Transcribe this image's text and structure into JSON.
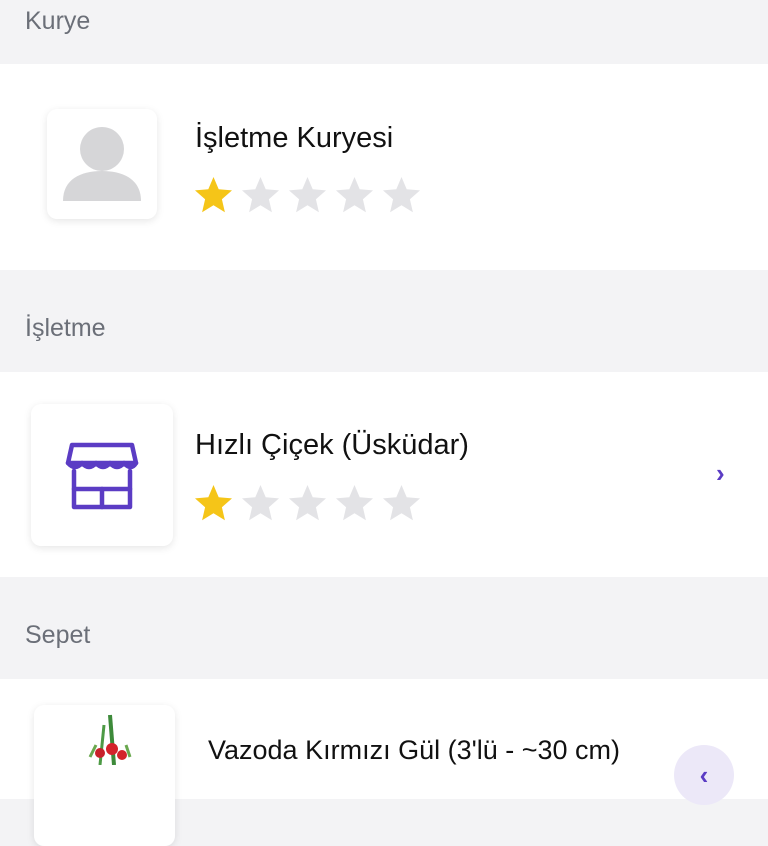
{
  "courier": {
    "section_label": "Kurye",
    "name": "İşletme Kuryesi",
    "rating": 1,
    "rating_max": 5
  },
  "business": {
    "section_label": "İşletme",
    "name": "Hızlı Çiçek (Üsküdar)",
    "rating": 1,
    "rating_max": 5
  },
  "basket": {
    "section_label": "Sepet",
    "item_name": "Vazoda Kırmızı Gül (3'lü - ~30 cm)"
  },
  "colors": {
    "accent": "#5b3cc4",
    "star_filled": "#f5c518",
    "star_empty": "#e3e3e6"
  },
  "icons": {
    "avatar": "user-placeholder-icon",
    "store": "store-awning-icon",
    "chevron": "chevron-right-icon"
  }
}
